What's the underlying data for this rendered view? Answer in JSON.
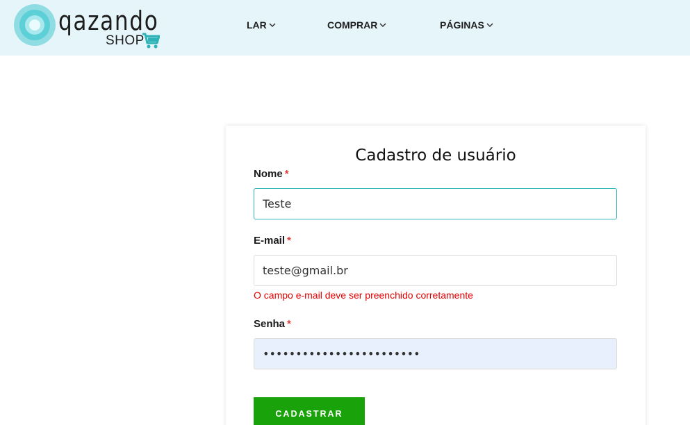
{
  "header": {
    "logo": {
      "brand": "QAZANDO",
      "sub": "SHOP"
    },
    "nav": [
      {
        "label": "LAR"
      },
      {
        "label": "COMPRAR"
      },
      {
        "label": "PÁGINAS"
      }
    ]
  },
  "form": {
    "title": "Cadastro de usuário",
    "name_label": "Nome",
    "name_value": "Teste",
    "email_label": "E-mail",
    "email_value": "teste@gmail.br",
    "email_error": "O campo e-mail deve ser preenchido corretamente",
    "password_label": "Senha",
    "password_value": "••••••••••••••••••••••••",
    "required_mark": "*",
    "submit_label": "CADASTRAR"
  },
  "colors": {
    "header_bg": "#e6f5f9",
    "accent": "#2bb3b8",
    "error": "#e00000",
    "button": "#1aa20a"
  }
}
